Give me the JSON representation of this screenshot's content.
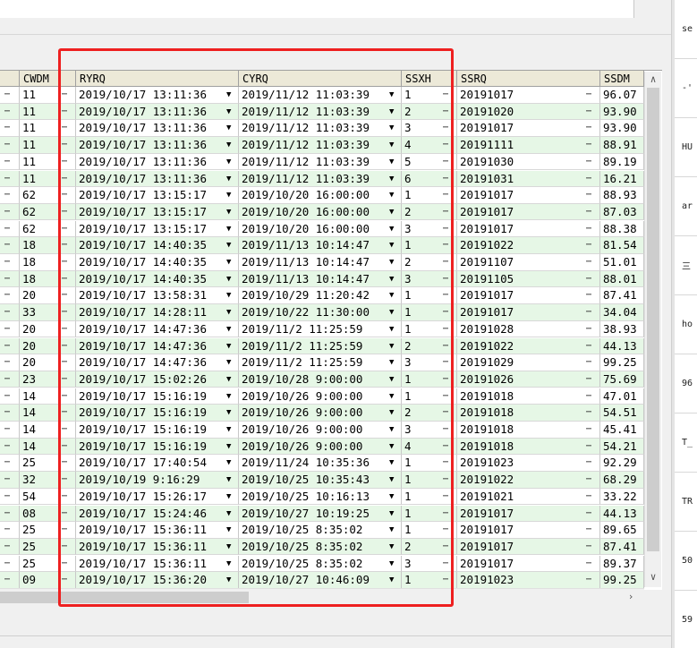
{
  "columns": [
    {
      "key": "c0",
      "label": ""
    },
    {
      "key": "cwdm",
      "label": "CWDM"
    },
    {
      "key": "ryrq",
      "label": "RYRQ"
    },
    {
      "key": "cyrq",
      "label": "CYRQ"
    },
    {
      "key": "ssxh",
      "label": "SSXH"
    },
    {
      "key": "ssrq",
      "label": "SSRQ"
    },
    {
      "key": "ssdm",
      "label": "SSDM"
    }
  ],
  "rows": [
    [
      "11",
      "2019/10/17 13:11:36",
      "2019/11/12 11:03:39",
      "1",
      "20191017",
      "96.07"
    ],
    [
      "11",
      "2019/10/17 13:11:36",
      "2019/11/12 11:03:39",
      "2",
      "20191020",
      "93.90"
    ],
    [
      "11",
      "2019/10/17 13:11:36",
      "2019/11/12 11:03:39",
      "3",
      "20191017",
      "93.90"
    ],
    [
      "11",
      "2019/10/17 13:11:36",
      "2019/11/12 11:03:39",
      "4",
      "20191111",
      "88.91"
    ],
    [
      "11",
      "2019/10/17 13:11:36",
      "2019/11/12 11:03:39",
      "5",
      "20191030",
      "89.19"
    ],
    [
      "11",
      "2019/10/17 13:11:36",
      "2019/11/12 11:03:39",
      "6",
      "20191031",
      "16.21"
    ],
    [
      "62",
      "2019/10/17 13:15:17",
      "2019/10/20 16:00:00",
      "1",
      "20191017",
      "88.93"
    ],
    [
      "62",
      "2019/10/17 13:15:17",
      "2019/10/20 16:00:00",
      "2",
      "20191017",
      "87.03"
    ],
    [
      "62",
      "2019/10/17 13:15:17",
      "2019/10/20 16:00:00",
      "3",
      "20191017",
      "88.38"
    ],
    [
      "18",
      "2019/10/17 14:40:35",
      "2019/11/13 10:14:47",
      "1",
      "20191022",
      "81.54"
    ],
    [
      "18",
      "2019/10/17 14:40:35",
      "2019/11/13 10:14:47",
      "2",
      "20191107",
      "51.01"
    ],
    [
      "18",
      "2019/10/17 14:40:35",
      "2019/11/13 10:14:47",
      "3",
      "20191105",
      "88.01"
    ],
    [
      "20",
      "2019/10/17 13:58:31",
      "2019/10/29 11:20:42",
      "1",
      "20191017",
      "87.41"
    ],
    [
      "33",
      "2019/10/17 14:28:11",
      "2019/10/22 11:30:00",
      "1",
      "20191017",
      "34.04"
    ],
    [
      "20",
      "2019/10/17 14:47:36",
      "2019/11/2 11:25:59",
      "1",
      "20191028",
      "38.93"
    ],
    [
      "20",
      "2019/10/17 14:47:36",
      "2019/11/2 11:25:59",
      "2",
      "20191022",
      "44.13"
    ],
    [
      "20",
      "2019/10/17 14:47:36",
      "2019/11/2 11:25:59",
      "3",
      "20191029",
      "99.25"
    ],
    [
      "23",
      "2019/10/17 15:02:26",
      "2019/10/28 9:00:00",
      "1",
      "20191026",
      "75.69"
    ],
    [
      "14",
      "2019/10/17 15:16:19",
      "2019/10/26 9:00:00",
      "1",
      "20191018",
      "47.01"
    ],
    [
      "14",
      "2019/10/17 15:16:19",
      "2019/10/26 9:00:00",
      "2",
      "20191018",
      "54.51"
    ],
    [
      "14",
      "2019/10/17 15:16:19",
      "2019/10/26 9:00:00",
      "3",
      "20191018",
      "45.41"
    ],
    [
      "14",
      "2019/10/17 15:16:19",
      "2019/10/26 9:00:00",
      "4",
      "20191018",
      "54.21"
    ],
    [
      "25",
      "2019/10/17 17:40:54",
      "2019/11/24 10:35:36",
      "1",
      "20191023",
      "92.29"
    ],
    [
      "32",
      "2019/10/19 9:16:29",
      "2019/10/25 10:35:43",
      "1",
      "20191022",
      "68.29"
    ],
    [
      "54",
      "2019/10/17 15:26:17",
      "2019/10/25 10:16:13",
      "1",
      "20191021",
      "33.22"
    ],
    [
      "08",
      "2019/10/17 15:24:46",
      "2019/10/27 10:19:25",
      "1",
      "20191017",
      "44.13"
    ],
    [
      "25",
      "2019/10/17 15:36:11",
      "2019/10/25 8:35:02",
      "1",
      "20191017",
      "89.65"
    ],
    [
      "25",
      "2019/10/17 15:36:11",
      "2019/10/25 8:35:02",
      "2",
      "20191017",
      "87.41"
    ],
    [
      "25",
      "2019/10/17 15:36:11",
      "2019/10/25 8:35:02",
      "3",
      "20191017",
      "89.37"
    ],
    [
      "09",
      "2019/10/17 15:36:20",
      "2019/10/27 10:46:09",
      "1",
      "20191023",
      "99.25"
    ]
  ],
  "right_panel": [
    "se",
    "-'",
    "HU",
    "ar",
    "三",
    "ho",
    "96",
    "T_",
    "TR",
    "50",
    "59"
  ],
  "icons": {
    "ellipsis": "⋯",
    "dropdown": "▼",
    "scroll_up": "∧",
    "scroll_down": "∨",
    "scroll_right": "›"
  },
  "colors": {
    "row_even": "#ffffff",
    "row_odd": "#e6f7e6",
    "header_bg": "#ece9d8",
    "highlight": "#ee2020"
  }
}
